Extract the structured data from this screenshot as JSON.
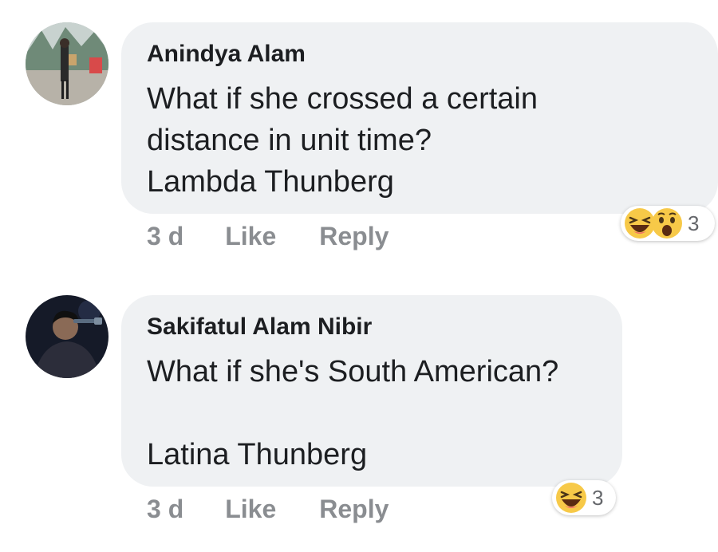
{
  "comments": [
    {
      "author": "Anindya Alam",
      "lines": [
        "What if she crossed a certain",
        "distance in unit time?",
        "Lambda Thunberg"
      ],
      "time": "3 d",
      "like_label": "Like",
      "reply_label": "Reply",
      "reactions": [
        "laughing-emoji",
        "wow-emoji"
      ],
      "reaction_count": "3"
    },
    {
      "author": "Sakifatul Alam Nibir",
      "lines": [
        "What if she's South American?",
        "",
        "Latina Thunberg"
      ],
      "time": "3 d",
      "like_label": "Like",
      "reply_label": "Reply",
      "reactions": [
        "laughing-emoji"
      ],
      "reaction_count": "3"
    }
  ],
  "colors": {
    "bubble": "#eff1f3",
    "text": "#1c1e21",
    "meta": "#8a8d91",
    "emoji_yellow": "#f7c948"
  }
}
